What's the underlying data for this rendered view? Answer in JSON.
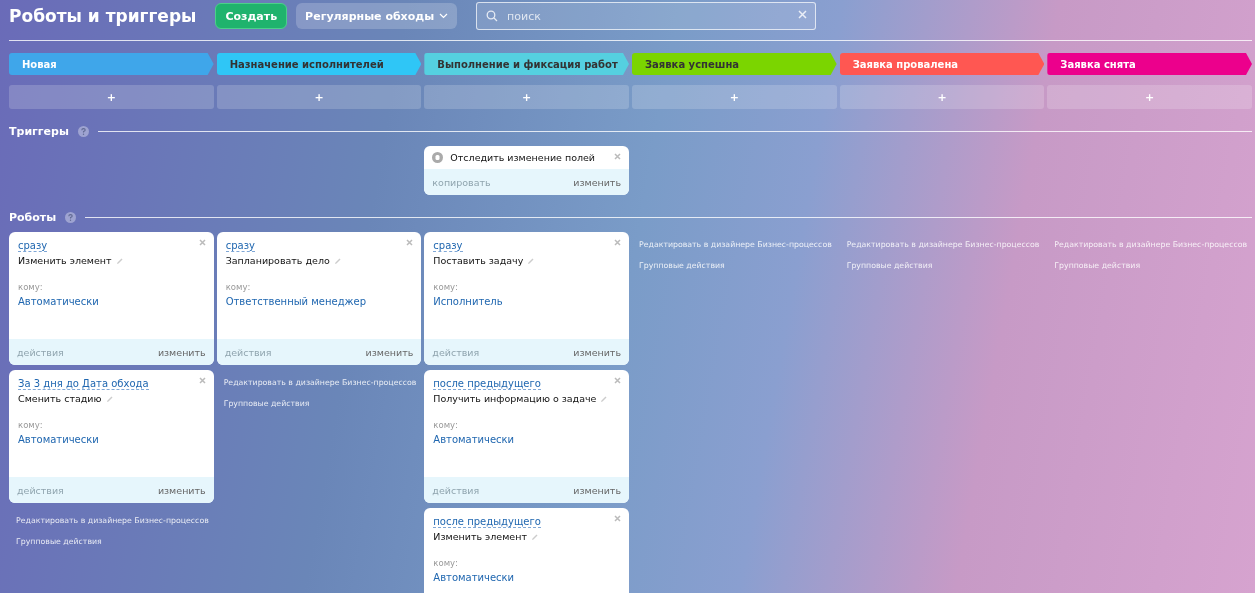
{
  "header": {
    "title": "Роботы и триггеры",
    "create_button": "Создать",
    "preset_button": "Регулярные обходы",
    "search": {
      "placeholder": "поиск"
    }
  },
  "sections": {
    "triggers": "Триггеры",
    "robots": "Роботы"
  },
  "columns": [
    {
      "stage": {
        "label": "Новая",
        "color": "#3fa6ea"
      },
      "add": "+",
      "robots": [
        {
          "delay": "сразу",
          "title": "Изменить элемент",
          "to_label": "кому:",
          "to": "Автоматически",
          "actions": "действия",
          "edit": "изменить"
        },
        {
          "delay": "За 3 дня до Дата обхода",
          "title": "Сменить стадию",
          "to_label": "кому:",
          "to": "Автоматически",
          "actions": "действия",
          "edit": "изменить"
        }
      ],
      "links": [
        "Редактировать в дизайнере Бизнес-процессов",
        "Групповые действия"
      ]
    },
    {
      "stage": {
        "label": "Назначение исполнителей",
        "color": "#2fc6f6"
      },
      "add": "+",
      "robots": [
        {
          "delay": "сразу",
          "title": "Запланировать дело",
          "to_label": "кому:",
          "to": "Ответственный менеджер",
          "actions": "действия",
          "edit": "изменить"
        }
      ],
      "links": [
        "Редактировать в дизайнере Бизнес-процессов",
        "Групповые действия"
      ]
    },
    {
      "stage": {
        "label": "Выполнение и фиксация работ",
        "color": "#55d0e0"
      },
      "add": "+",
      "triggers": [
        {
          "title": "Отследить изменение полей",
          "copy": "копировать",
          "edit": "изменить"
        }
      ],
      "robots": [
        {
          "delay": "сразу",
          "title": "Поставить задачу",
          "to_label": "кому:",
          "to": "Исполнитель",
          "actions": "действия",
          "edit": "изменить"
        },
        {
          "delay": "после предыдущего",
          "title": "Получить информацию о задаче",
          "to_label": "кому:",
          "to": "Автоматически",
          "actions": "действия",
          "edit": "изменить"
        },
        {
          "delay": "после предыдущего",
          "title": "Изменить элемент",
          "to_label": "кому:",
          "to": "Автоматически"
        }
      ]
    },
    {
      "stage": {
        "label": "Заявка успешна",
        "color": "#7bd500"
      },
      "add": "+",
      "links": [
        "Редактировать в дизайнере Бизнес-процессов",
        "Групповые действия"
      ]
    },
    {
      "stage": {
        "label": "Заявка провалена",
        "color": "#ff5752"
      },
      "add": "+",
      "links": [
        "Редактировать в дизайнере Бизнес-процессов",
        "Групповые действия"
      ]
    },
    {
      "stage": {
        "label": "Заявка снята",
        "color": "#ec008c"
      },
      "add": "+",
      "links": [
        "Редактировать в дизайнере Бизнес-процессов",
        "Групповые действия"
      ]
    }
  ]
}
